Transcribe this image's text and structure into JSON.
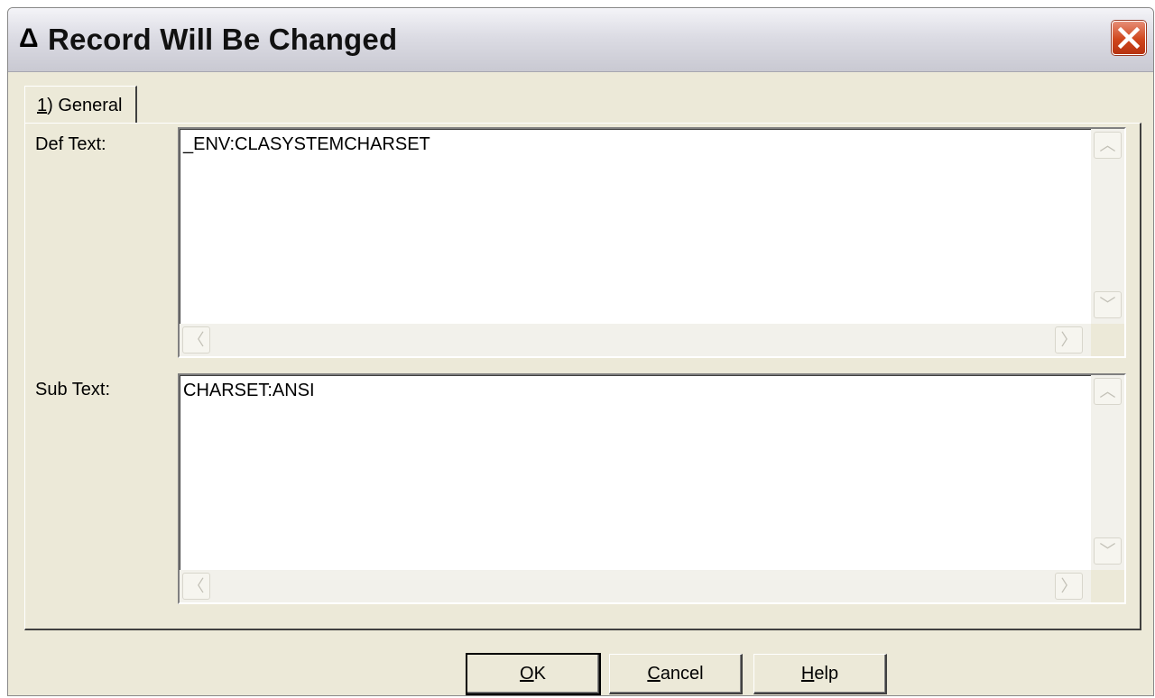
{
  "window": {
    "title_icon": "Δ",
    "title": "Record Will Be Changed",
    "close_icon": "close-icon"
  },
  "tabs": [
    {
      "mnemonic": "1",
      "label_rest": ") General"
    }
  ],
  "fields": {
    "def_text": {
      "label": "Def Text:",
      "value": "_ENV:CLASYSTEMCHARSET"
    },
    "sub_text": {
      "label": "Sub Text:",
      "value": "CHARSET:ANSI"
    }
  },
  "scroll_glyphs": {
    "up": "︿",
    "down": "﹀",
    "left": "〈",
    "right": "〉"
  },
  "buttons": {
    "ok": {
      "mnemonic": "O",
      "rest": "K"
    },
    "cancel": {
      "mnemonic": "C",
      "rest": "ancel"
    },
    "help": {
      "mnemonic": "H",
      "rest": "elp"
    }
  }
}
